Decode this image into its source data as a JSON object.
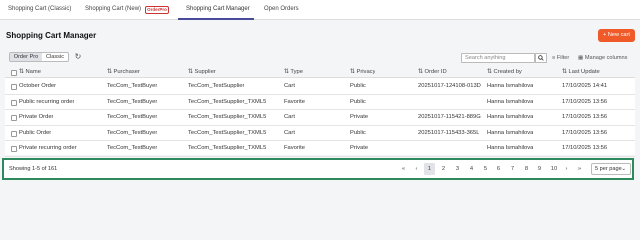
{
  "tabs": [
    {
      "label": "Shopping Cart (Classic)"
    },
    {
      "label": "Shopping Cart (New)"
    },
    {
      "label": "Shopping Cart Manager"
    },
    {
      "label": "Open Orders"
    }
  ],
  "logo_badge": "OrderPro",
  "page": {
    "title": "Shopping Cart Manager",
    "new_cart_label": "+ New cart"
  },
  "view_toggle": {
    "options": [
      "Order Pro",
      "Classic"
    ],
    "selected": "Order Pro"
  },
  "toolbar": {
    "search_placeholder": "Search anything",
    "filter_label": "Filter",
    "manage_columns_label": "Manage columns"
  },
  "table": {
    "headers": [
      "Name",
      "Purchaser",
      "Supplier",
      "Type",
      "Privacy",
      "Order ID",
      "Created by",
      "Last Update"
    ],
    "rows": [
      [
        "October Order",
        "TecCom_TestBuyer",
        "TecCom_TestSupplier",
        "Cart",
        "Public",
        "20251017-124108-013D",
        "Hanna Ismahilova",
        "17/10/2025 14:41"
      ],
      [
        "Public recurring order",
        "TecCom_TestBuyer",
        "TecCom_TestSupplier_TXML5",
        "Favorite",
        "Public",
        "",
        "Hanna Ismahilova",
        "17/10/2025 13:56"
      ],
      [
        "Private Order",
        "TecCom_TestBuyer",
        "TecCom_TestSupplier_TXML5",
        "Cart",
        "Private",
        "20251017-115421-889G",
        "Hanna Ismahilova",
        "17/10/2025 13:56"
      ],
      [
        "Public Order",
        "TecCom_TestBuyer",
        "TecCom_TestSupplier_TXML5",
        "Cart",
        "Public",
        "20251017-115433-365L",
        "Hanna Ismahilova",
        "17/10/2025 13:56"
      ],
      [
        "Private recurring order",
        "TecCom_TestBuyer",
        "TecCom_TestSupplier_TXML5",
        "Favorite",
        "Private",
        "",
        "Hanna Ismahilova",
        "17/10/2025 13:56"
      ]
    ]
  },
  "pagination": {
    "showing_text": "Showing 1-5 of 161",
    "first": "«",
    "prev": "‹",
    "pages": [
      "1",
      "2",
      "3",
      "4",
      "5",
      "6",
      "7",
      "8",
      "9",
      "10"
    ],
    "active_page": "1",
    "next": "›",
    "last": "»",
    "per_page": "5 per page"
  },
  "colors": {
    "accent": "#f05a28",
    "tab_underline": "#4a4a9a",
    "highlight_border": "#2e8a5c"
  }
}
